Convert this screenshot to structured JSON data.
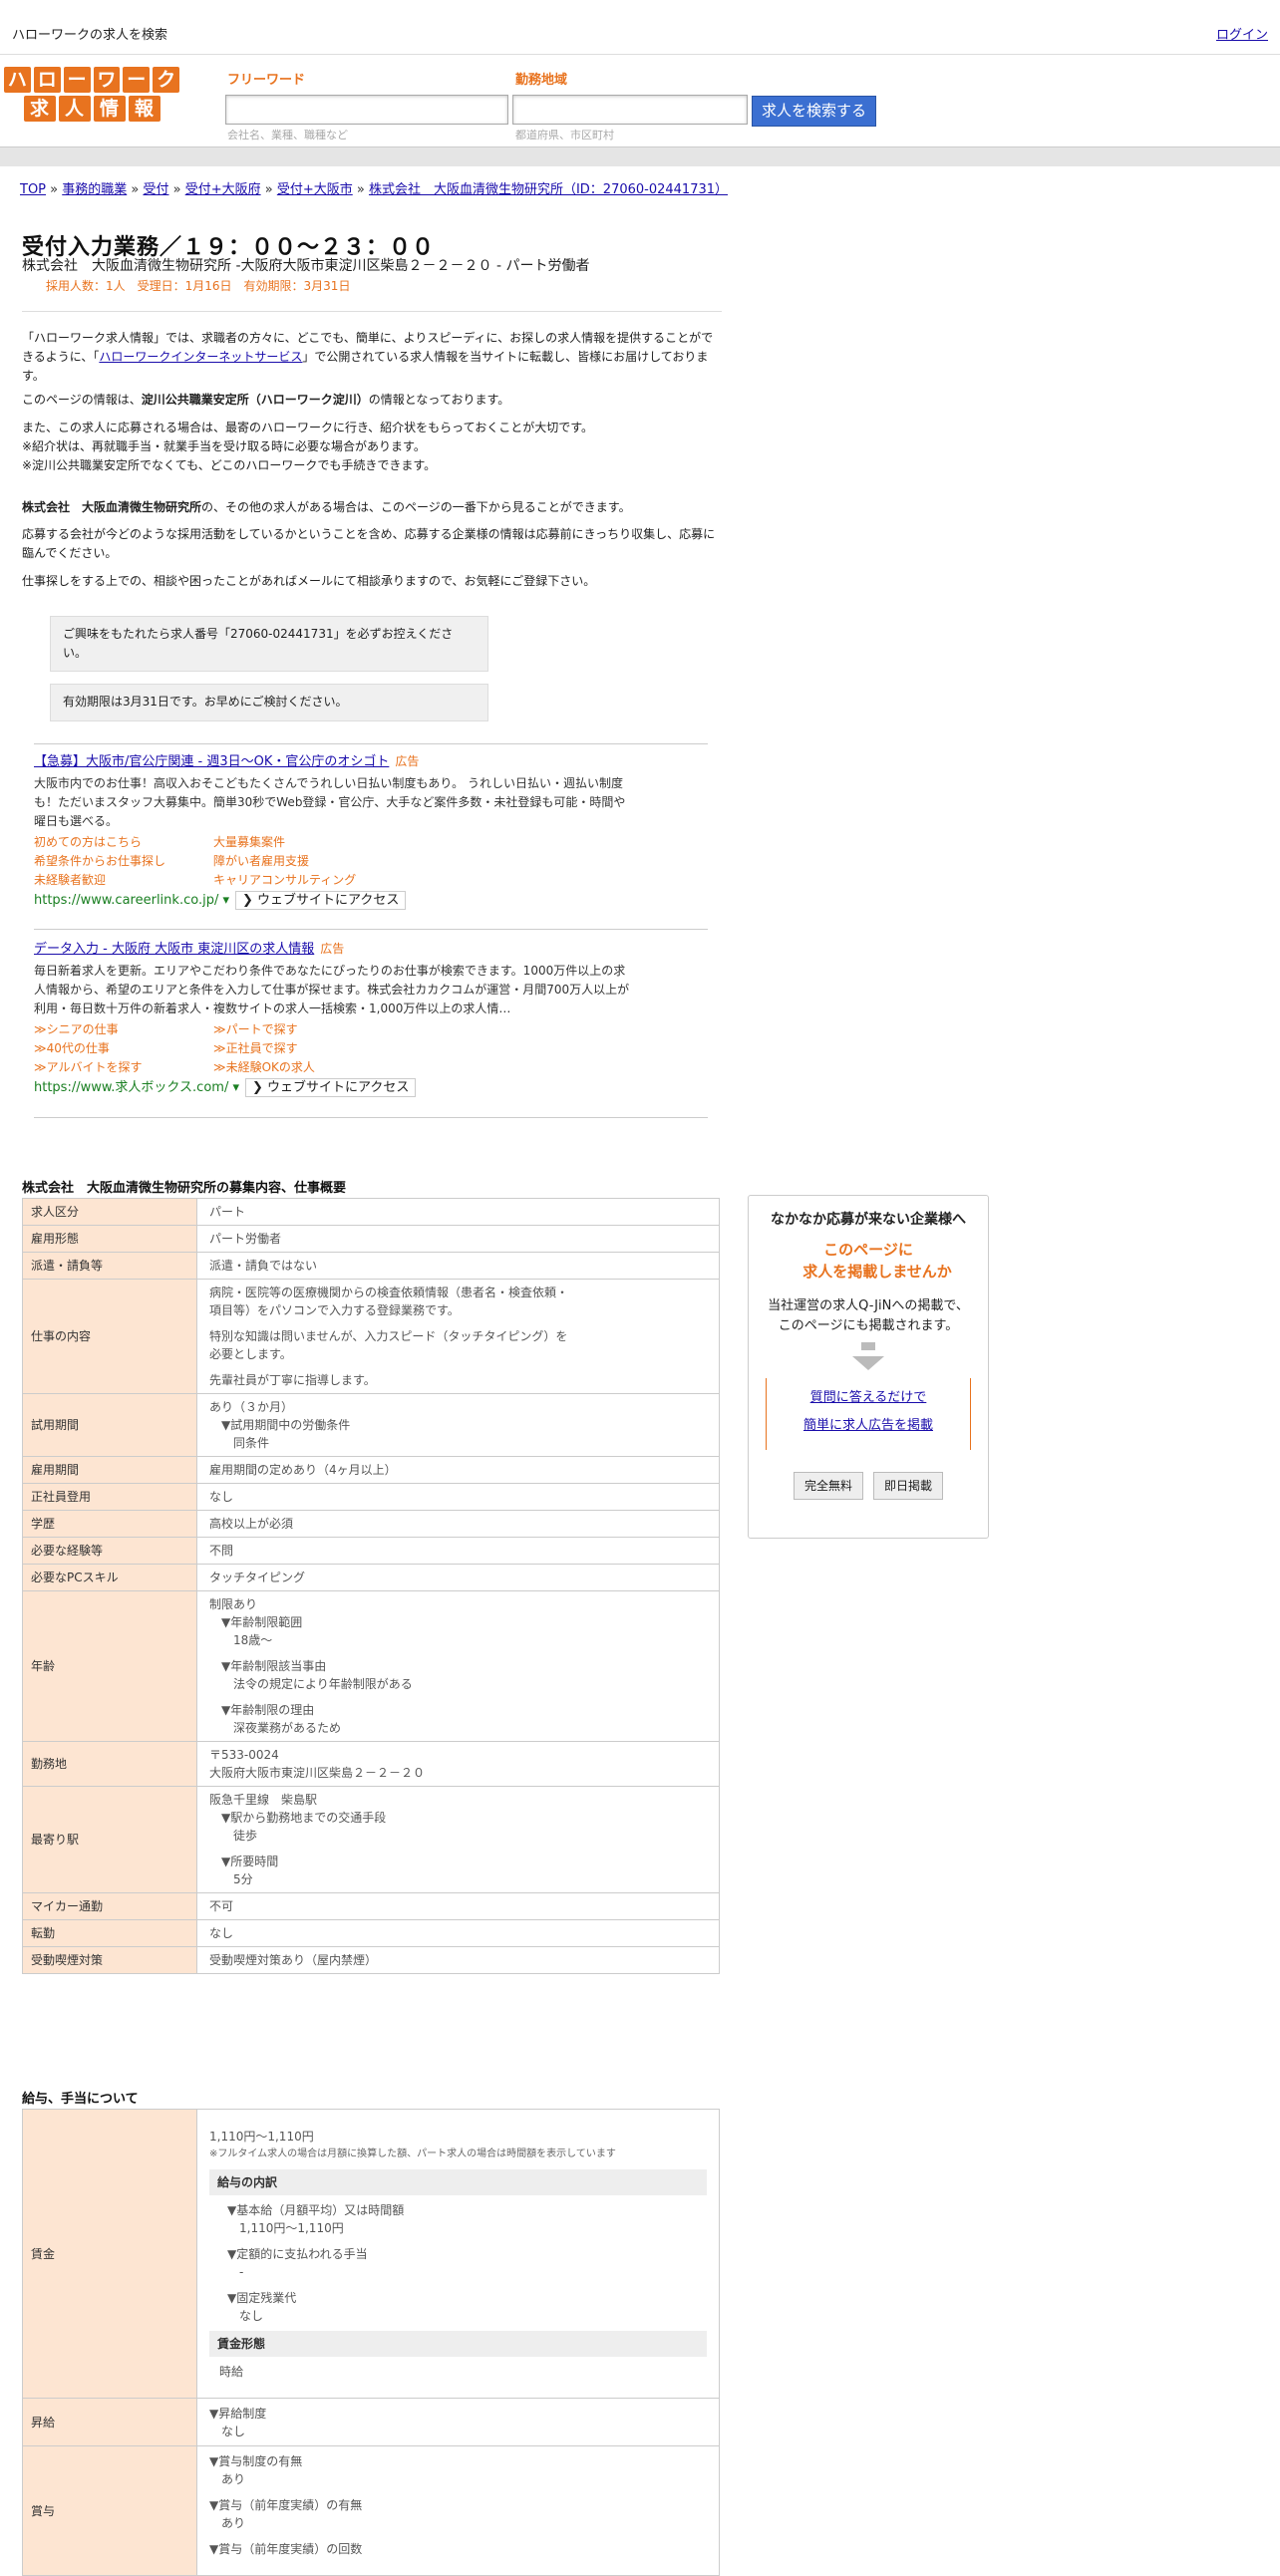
{
  "topbar": {
    "title": "ハローワークの求人を検索",
    "login": "ログイン"
  },
  "logo": {
    "row1": [
      "ハ",
      "ロ",
      "ー",
      "ワ",
      "ー",
      "ク"
    ],
    "row2": [
      "求",
      "人",
      "情",
      "報"
    ]
  },
  "search": {
    "freeword_label": "フリーワード",
    "freeword_hint": "会社名、業種、職種など",
    "area_label": "勤務地域",
    "area_hint": "都道府県、市区町村",
    "button": "求人を検索する"
  },
  "breadcrumb": [
    "TOP",
    "事務的職業",
    "受付",
    "受付+大阪府",
    "受付+大阪市",
    "株式会社　大阪血清微生物研究所（ID：27060-02441731）"
  ],
  "job": {
    "title": "受付入力業務／１９：００～２３：００",
    "subtitle": "株式会社　大阪血清微生物研究所 -大阪府大阪市東淀川区柴島２－２－２０ - パート労働者",
    "meta": "採用人数：1人　受理日：1月16日　有効期限：3月31日"
  },
  "intro": {
    "p1_a": "「ハローワーク求人情報」では、求職者の方々に、どこでも、簡単に、よりスピーディに、お探しの求人情報を提供することができるように、「",
    "p1_link": "ハローワークインターネットサービス",
    "p1_b": "」で公開されている求人情報を当サイトに転載し、皆様にお届けしております。",
    "p2_a": "このページの情報は、",
    "p2_bold": "淀川公共職業安定所（ハローワーク淀川）",
    "p2_b": "の情報となっております。",
    "p3": "また、この求人に応募される場合は、最寄のハローワークに行き、紹介状をもらっておくことが大切です。",
    "p4": "※紹介状は、再就職手当・就業手当を受け取る時に必要な場合があります。",
    "p5": "※淀川公共職業安定所でなくても、どこのハローワークでも手続きできます。",
    "p6_bold": "株式会社　大阪血清微生物研究所",
    "p6": "の、その他の求人がある場合は、このページの一番下から見ることができます。",
    "p7": "応募する会社が今どのような採用活動をしているかということを含め、応募する企業様の情報は応募前にきっちり収集し、応募に臨んでください。",
    "p8": "仕事探しをする上での、相談や困ったことがあればメールにて相談承りますので、お気軽にご登録下さい。"
  },
  "notes": [
    "ご興味をもたれたら求人番号「27060-02441731」を必ずお控えください。",
    "有効期限は3月31日です。お早めにご検討ください。"
  ],
  "ads": [
    {
      "title": "【急募】大阪市/官公庁関連 - 週3日～OK・官公庁のオシゴト",
      "tag": "広告",
      "desc": "大阪市内でのお仕事！高収入おそこどもたくさんでうれしい日払い制度もあり。 うれしい日払い・週払い制度も！ただいまスタッフ大募集中。簡単30秒でWeb登録・官公庁、大手など案件多数・未社登録も可能・時間や曜日も選べる。",
      "links": [
        "初めての方はこちら",
        "大量募集案件",
        "希望条件からお仕事探し",
        "障がい者雇用支援",
        "未経験者歓迎",
        "キャリアコンサルティング"
      ],
      "url": "https://www.careerlink.co.jp/",
      "visit": "❯ ウェブサイトにアクセス"
    },
    {
      "title": "データ入力 - 大阪府 大阪市 東淀川区の求人情報",
      "tag": "広告",
      "desc": "毎日新着求人を更新。エリアやこだわり条件であなたにぴったりのお仕事が検索できます。1000万件以上の求人情報から、希望のエリアと条件を入力して仕事が探せます。株式会社カカクコムが運営・月間700万人以上が利用・毎日数十万件の新着求人・複数サイトの求人一括検索・1,000万件以上の求人情…",
      "links": [
        "≫シニアの仕事",
        "≫パートで探す",
        "≫40代の仕事",
        "≫正社員で探す",
        "≫アルバイトを探す",
        "≫未経験OKの求人"
      ],
      "url": "https://www.求人ボックス.com/",
      "visit": "❯ ウェブサイトにアクセス"
    }
  ],
  "section1_title": "株式会社　大阪血清微生物研究所の募集内容、仕事概要",
  "table1": [
    {
      "k": "求人区分",
      "v": [
        "パート"
      ]
    },
    {
      "k": "雇用形態",
      "v": [
        "パート労働者"
      ]
    },
    {
      "k": "派遣・請負等",
      "v": [
        "派遣・請負ではない"
      ]
    },
    {
      "k": "仕事の内容",
      "v": [
        "病院・医院等の医療機関からの検査依頼情報（患者名・検査依頼・",
        "項目等）をパソコンで入力する登録業務です。",
        "",
        "特別な知識は問いませんが、入力スピード（タッチタイピング）を",
        "必要とします。",
        "",
        "先輩社員が丁寧に指導します。"
      ]
    },
    {
      "k": "試用期間",
      "v": [
        "あり（３か月）",
        "　▼試用期間中の労働条件",
        "　　同条件"
      ]
    },
    {
      "k": "雇用期間",
      "v": [
        "雇用期間の定めあり（4ヶ月以上）"
      ]
    },
    {
      "k": "正社員登用",
      "v": [
        "なし"
      ]
    },
    {
      "k": "学歴",
      "v": [
        "高校以上が必須"
      ]
    },
    {
      "k": "必要な経験等",
      "v": [
        "不問"
      ]
    },
    {
      "k": "必要なPCスキル",
      "v": [
        "タッチタイピング"
      ]
    },
    {
      "k": "年齢",
      "v": [
        "制限あり",
        "　▼年齢制限範囲",
        "　　18歳～",
        "",
        "　▼年齢制限該当事由",
        "　　法令の規定により年齢制限がある",
        "",
        "　▼年齢制限の理由",
        "　　深夜業務があるため"
      ]
    },
    {
      "k": "勤務地",
      "v": [
        "〒533-0024",
        "大阪府大阪市東淀川区柴島２－２－２０"
      ]
    },
    {
      "k": "最寄り駅",
      "v": [
        "阪急千里線　柴島駅",
        "　▼駅から勤務地までの交通手段",
        "　　徒歩",
        "",
        "　▼所要時間",
        "　　5分"
      ]
    },
    {
      "k": "マイカー通勤",
      "v": [
        "不可"
      ]
    },
    {
      "k": "転勤",
      "v": [
        "なし"
      ]
    },
    {
      "k": "受動喫煙対策",
      "v": [
        "受動喫煙対策あり（屋内禁煙）"
      ]
    }
  ],
  "section2_title": "給与、手当について",
  "wage": {
    "k": "賃金",
    "range": "1,110円〜1,110円",
    "note": "※フルタイム求人の場合は月額に換算した額、パート求人の場合は時間額を表示しています",
    "breakdown_title": "給与の内訳",
    "items": [
      "▼基本給（月額平均）又は時間額",
      "　1,110円〜1,110円",
      "",
      "▼定額的に支払われる手当",
      "　-",
      "",
      "▼固定残業代",
      "　なし"
    ],
    "form_title": "賃金形態",
    "form": "時給"
  },
  "raise": {
    "k": "昇給",
    "v": [
      "▼昇給制度",
      "　なし"
    ]
  },
  "bonus": {
    "k": "賞与",
    "v": [
      "▼賞与制度の有無",
      "　あり",
      "",
      "▼賞与（前年度実績）の有無",
      "　あり",
      "",
      "▼賞与（前年度実績）の回数"
    ]
  },
  "side": {
    "heading": "なかなか応募が来ない企業様へ",
    "catch1": "このページに",
    "catch2": "求人を掲載しませんか",
    "body1": "当社運営の求人Q-JiNへの掲載で、",
    "body2": "このページにも掲載されます。",
    "link1": "質問に答えるだけで",
    "link2": "簡単に求人広告を掲載",
    "btn1": "完全無料",
    "btn2": "即日掲載"
  }
}
